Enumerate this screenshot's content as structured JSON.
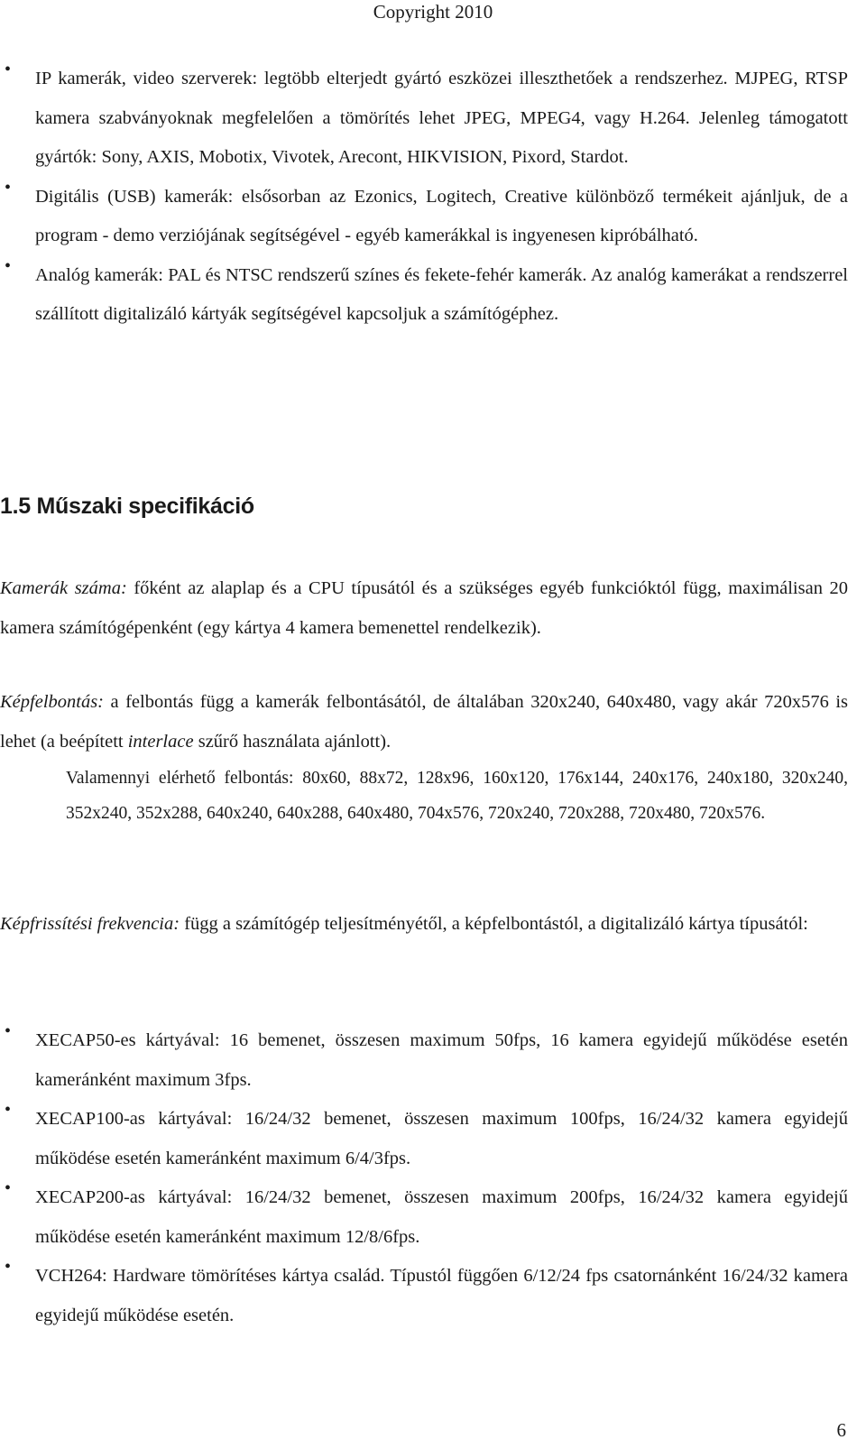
{
  "header": {
    "text": "Copyright 2010"
  },
  "intro_bullets": [
    {
      "text": "IP kamerák, video szerverek: legtöbb elterjedt gyártó eszközei illeszthetőek a rendszerhez. MJPEG, RTSP kamera szabványoknak megfelelően a tömörítés lehet JPEG, MPEG4, vagy H.264. Jelenleg támogatott gyártók: Sony, AXIS, Mobotix, Vivotek, Arecont, HIKVISION, Pixord, Stardot."
    },
    {
      "text": "Digitális (USB) kamerák: elsősorban az Ezonics, Logitech, Creative különböző termékeit ajánljuk, de a program - demo verziójának segítségével - egyéb kamerákkal is ingyenesen kipróbálható."
    },
    {
      "text": "Analóg kamerák: PAL és NTSC rendszerű színes és fekete-fehér kamerák. Az analóg kamerákat a rendszerrel szállított digitalizáló kártyák segítségével kapcsoljuk a számítógéphez."
    }
  ],
  "section": {
    "heading": "1.5 Műszaki specifikáció"
  },
  "camera_count": {
    "label": "Kamerák száma:",
    "text": " főként az alaplap és a CPU típusától és a szükséges egyéb funkcióktól függ, maximálisan 20 kamera számítógépenként (egy kártya 4 kamera bemenettel rendelkezik)."
  },
  "resolution": {
    "label": "Képfelbontás:",
    "text_before": " a felbontás függ a kamerák felbontásától, de általában 320x240, 640x480, vagy akár 720x576 is lehet (a beépített ",
    "emphasis": "interlace",
    "text_after": " szűrő használata ajánlott).",
    "all_label": "Valamennyi elérhető felbontás:",
    "all_values": " 80x60, 88x72, 128x96, 160x120, 176x144, 240x176, 240x180, 320x240, 352x240, 352x288, 640x240, 640x288, 640x480, 704x576, 720x240, 720x288, 720x480, 720x576."
  },
  "refresh_rate": {
    "label": "Képfrissítési frekvencia:",
    "text": " függ a számítógép teljesítményétől, a képfelbontástól, a digitalizáló kártya típusától:"
  },
  "card_bullets": [
    {
      "text": "XECAP50-es kártyával: 16 bemenet, összesen maximum 50fps, 16 kamera egyidejű működése esetén kameránként maximum 3fps."
    },
    {
      "text": "XECAP100-as kártyával: 16/24/32 bemenet, összesen maximum 100fps, 16/24/32 kamera egyidejű működése esetén kameránként maximum 6/4/3fps."
    },
    {
      "text": "XECAP200-as kártyával: 16/24/32 bemenet, összesen maximum 200fps, 16/24/32 kamera egyidejű működése esetén kameránként maximum 12/8/6fps."
    },
    {
      "text": "VCH264: Hardware tömörítéses kártya család. Típustól függően 6/12/24 fps csatornánként 16/24/32 kamera egyidejű működése esetén."
    }
  ],
  "bullet_glyph": "•",
  "page_number": "6"
}
